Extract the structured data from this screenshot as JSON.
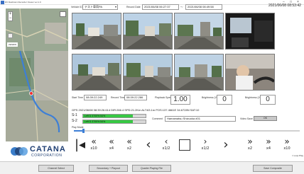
{
  "window": {
    "title": "DV Dashcam Recorder Viewer ver.1.0"
  },
  "header": {
    "vehicle_label": "Vehicle ID",
    "vehicle_value": "テスト車両PA",
    "record_date_label": "Record Date",
    "record_start": "2021/06/08 06:27:37",
    "range_sep": "〜",
    "record_end": "2021/06/08 08:49:58",
    "current_datetime": "2021/06/08 08:53:42"
  },
  "map": {
    "badge": "ZENRIN",
    "zoom_in": "+",
    "zoom_out": "−"
  },
  "logo": {
    "word": "CATANA",
    "sub": "CORPORATION"
  },
  "timing": {
    "start_label": "Start Time",
    "start_value": "08:39:22.249",
    "record_label": "Record Time",
    "record_value": "08:39:22.286",
    "speed_label": "Playback Speed",
    "speed_value": "1.00",
    "brightness_label": "Brightness (Video1)",
    "brightness_value": "0",
    "brightness2_label": "Brightness (Video2)",
    "brightness2_value": "0"
  },
  "gps": {
    "line": "GPS 2021/06/08 08:39:26.614   DIR:266.4   SPD:21.2Km   ALT:63.1m   POS:137.4661E 34.6728N   SAT:10"
  },
  "sensors": [
    {
      "label": "S-1",
      "text": "Left D 3700% 54%",
      "fill": 0.8
    },
    {
      "label": "S-2",
      "text": "Left D 3700% 54%",
      "fill": 0.8
    }
  ],
  "driver": {
    "label": "Comment",
    "value": "Hamamatsu  Shizuoka  #01",
    "ok_label": "Video Save",
    "ok_btn": "OK"
  },
  "playmode": {
    "label": "Play Mode",
    "progress": 0.04
  },
  "playback": {
    "buttons": [
      {
        "glyph": "|◀",
        "label": ""
      },
      {
        "glyph": "«",
        "label": "x10"
      },
      {
        "glyph": "«",
        "label": "x4"
      },
      {
        "glyph": "«",
        "label": "x2"
      },
      {
        "glyph": "‹",
        "label": ""
      },
      {
        "glyph": "‹",
        "label": "x1/2"
      },
      {
        "glyph": "",
        "label": ""
      },
      {
        "glyph": "›",
        "label": "x1/2"
      },
      {
        "glyph": "›",
        "label": ""
      },
      {
        "glyph": "»",
        "label": "x2"
      },
      {
        "glyph": "»",
        "label": "x4"
      },
      {
        "glyph": "»",
        "label": "x10"
      }
    ],
    "loop_label": "Loop Play"
  },
  "bottom": {
    "buttons": [
      "Channel Select",
      "Secondary + Playout",
      "Quarter Playing File",
      "Save Composite"
    ]
  },
  "colors": {
    "accent": "#3d7fd6",
    "sensor_fill": "#37c843",
    "logo": "#1f3f73"
  }
}
